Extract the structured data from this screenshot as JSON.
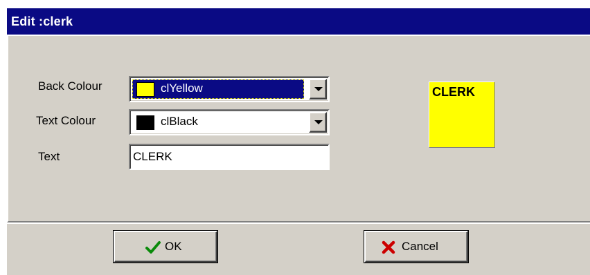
{
  "window": {
    "title": "Edit :clerk"
  },
  "form": {
    "back_colour": {
      "label": "Back Colour",
      "value": "clYellow",
      "swatch_color": "#ffff00"
    },
    "text_colour": {
      "label": "Text Colour",
      "value": "clBlack",
      "swatch_color": "#000000"
    },
    "text": {
      "label": "Text",
      "value": "CLERK"
    }
  },
  "preview": {
    "text": "CLERK",
    "background": "#ffff00",
    "text_color": "#000000"
  },
  "buttons": {
    "ok_label": "OK",
    "ok_icon": "checkmark-icon",
    "cancel_label": "Cancel",
    "cancel_icon": "red-x-icon"
  },
  "colors": {
    "titlebar": "#0a0a84",
    "dialog_face": "#d4d0c8",
    "selection_highlight": "#0a0a84",
    "ok_check": "#0a8a0a",
    "cancel_x": "#cc0000"
  }
}
